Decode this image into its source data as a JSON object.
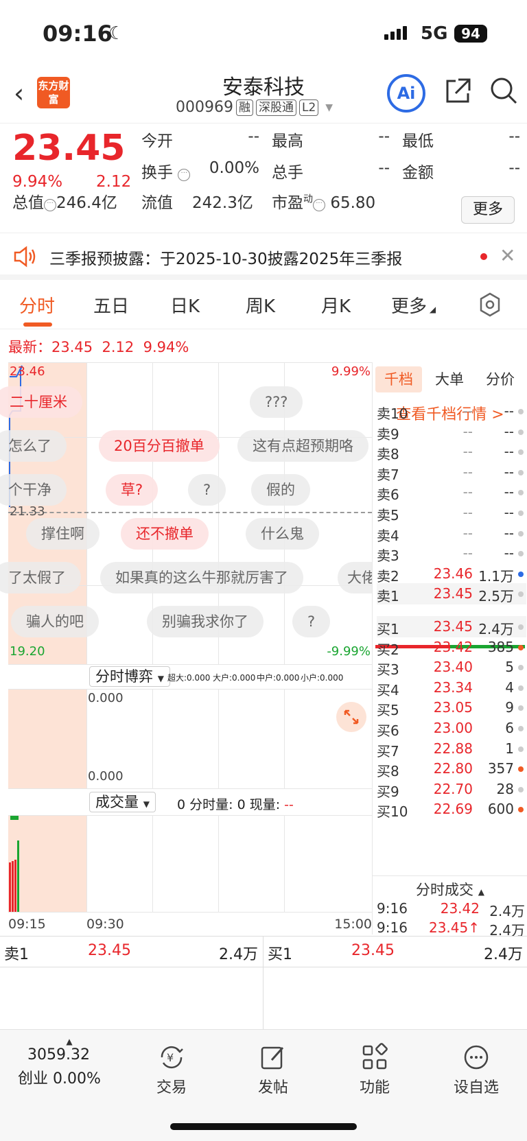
{
  "status": {
    "time": "09:16",
    "network": "5G",
    "battery": "94"
  },
  "header": {
    "logo_text": "东方财富",
    "stock_name": "安泰科技",
    "stock_code": "000969",
    "tags": [
      "融",
      "深股通",
      "L2"
    ],
    "ai_label": "Ai"
  },
  "quote": {
    "price": "23.45",
    "change_pct": "9.94%",
    "change": "2.12",
    "fields": {
      "open_label": "今开",
      "open_value": "--",
      "high_label": "最高",
      "high_value": "--",
      "low_label": "最低",
      "low_value": "--",
      "turnover_label": "换手",
      "turnover_value": "0.00%",
      "volume_label": "总手",
      "volume_value": "--",
      "amount_label": "金额",
      "amount_value": "--",
      "mktcap_label": "总值",
      "mktcap_value": "246.4亿",
      "float_label": "流值",
      "float_value": "242.3亿",
      "pe_label": "市盈",
      "pe_sup": "动",
      "pe_value": "65.80"
    },
    "more_label": "更多"
  },
  "notice": {
    "text": "三季报预披露：于2025-10-30披露2025年三季报"
  },
  "tabs": [
    {
      "label": "分时",
      "active": true
    },
    {
      "label": "五日"
    },
    {
      "label": "日K"
    },
    {
      "label": "周K"
    },
    {
      "label": "月K"
    },
    {
      "label": "更多"
    }
  ],
  "latest": {
    "prefix": "最新：",
    "price": "23.45",
    "change": "2.12",
    "pct": "9.94%"
  },
  "chart": {
    "top_price": "23.46",
    "top_pct": "9.99%",
    "mid_price": "21.33",
    "bottom_price": "19.20",
    "bottom_pct": "-9.99%"
  },
  "danmu": [
    {
      "text": "二十厘米",
      "hot": true
    },
    {
      "text": "???",
      "hot": false
    },
    {
      "text": "怎么了",
      "hot": false
    },
    {
      "text": "20百分百撤单",
      "hot": true
    },
    {
      "text": "这有点超预期咯",
      "hot": false
    },
    {
      "text": "个干净",
      "hot": false
    },
    {
      "text": "草?",
      "hot": true
    },
    {
      "text": "?",
      "hot": false
    },
    {
      "text": "假的",
      "hot": false
    },
    {
      "text": "撑住啊",
      "hot": false
    },
    {
      "text": "还不撤单",
      "hot": true
    },
    {
      "text": "什么鬼",
      "hot": false
    },
    {
      "text": "了太假了",
      "hot": false
    },
    {
      "text": "如果真的这么牛那就厉害了",
      "hot": false
    },
    {
      "text": "大佬",
      "hot": false
    },
    {
      "text": "骗人的吧",
      "hot": false
    },
    {
      "text": "别骗我求你了",
      "hot": false
    },
    {
      "text": "?",
      "hot": false
    }
  ],
  "sub1": {
    "select_label": "分时博弈",
    "legend": [
      {
        "label": "超大:0.000",
        "color": "#e8262b"
      },
      {
        "label": "大户:0.000",
        "color": "#f5a623"
      },
      {
        "label": "中户:0.000",
        "color": "#2d6be4"
      },
      {
        "label": "小户:0.000",
        "color": "#1aa531"
      }
    ],
    "top_value": "0.000",
    "bottom_value": "0.000"
  },
  "sub2": {
    "select_label": "成交量",
    "info": "0 分时量: 0 现量: ",
    "info_tail": "--"
  },
  "time_axis": {
    "start": "09:15",
    "mid": "09:30",
    "end": "15:00"
  },
  "book": {
    "tabs": [
      "千档",
      "大单",
      "分价"
    ],
    "view_link": "查看千档行情 >",
    "asks": [
      {
        "name": "卖10",
        "price": "--",
        "vol": "--",
        "dot": "#ccc"
      },
      {
        "name": "卖9",
        "price": "--",
        "vol": "--",
        "dot": "#ccc"
      },
      {
        "name": "卖8",
        "price": "--",
        "vol": "--",
        "dot": "#ccc"
      },
      {
        "name": "卖7",
        "price": "--",
        "vol": "--",
        "dot": "#ccc"
      },
      {
        "name": "卖6",
        "price": "--",
        "vol": "--",
        "dot": "#ccc"
      },
      {
        "name": "卖5",
        "price": "--",
        "vol": "--",
        "dot": "#ccc"
      },
      {
        "name": "卖4",
        "price": "--",
        "vol": "--",
        "dot": "#ccc"
      },
      {
        "name": "卖3",
        "price": "--",
        "vol": "--",
        "dot": "#ccc"
      },
      {
        "name": "卖2",
        "price": "23.46",
        "vol": "1.1万",
        "dot": "#2d6be4"
      },
      {
        "name": "卖1",
        "price": "23.45",
        "vol": "2.5万",
        "dot": "#ccc"
      }
    ],
    "bids": [
      {
        "name": "买1",
        "price": "23.45",
        "vol": "2.4万",
        "dot": "#ccc"
      },
      {
        "name": "买2",
        "price": "23.42",
        "vol": "385",
        "dot": "#f05a23"
      },
      {
        "name": "买3",
        "price": "23.40",
        "vol": "5",
        "dot": "#ccc"
      },
      {
        "name": "买4",
        "price": "23.34",
        "vol": "4",
        "dot": "#ccc"
      },
      {
        "name": "买5",
        "price": "23.05",
        "vol": "9",
        "dot": "#ccc"
      },
      {
        "name": "买6",
        "price": "23.00",
        "vol": "6",
        "dot": "#ccc"
      },
      {
        "name": "买7",
        "price": "22.88",
        "vol": "1",
        "dot": "#ccc"
      },
      {
        "name": "买8",
        "price": "22.80",
        "vol": "357",
        "dot": "#f05a23"
      },
      {
        "name": "买9",
        "price": "22.70",
        "vol": "28",
        "dot": "#ccc"
      },
      {
        "name": "买10",
        "price": "22.69",
        "vol": "600",
        "dot": "#f05a23"
      }
    ],
    "trades_header": "分时成交",
    "trades": [
      {
        "time": "9:16",
        "price": "23.42",
        "vol": "2.4万"
      },
      {
        "time": "9:16",
        "price": "23.45↑",
        "vol": "2.4万"
      }
    ]
  },
  "bestrow": {
    "ask_label": "卖1",
    "ask_price": "23.45",
    "ask_vol": "2.4万",
    "bid_label": "买1",
    "bid_price": "23.45",
    "bid_vol": "2.4万"
  },
  "bottom": {
    "index_value": "3059.32",
    "index_name": "创业",
    "index_pct": "0.00%",
    "items": [
      {
        "label": "交易"
      },
      {
        "label": "发帖"
      },
      {
        "label": "功能"
      },
      {
        "label": "设自选"
      }
    ]
  },
  "colors": {
    "up": "#e8262b",
    "down": "#1aa531",
    "accent": "#f05a23",
    "ai": "#2d6be4"
  }
}
